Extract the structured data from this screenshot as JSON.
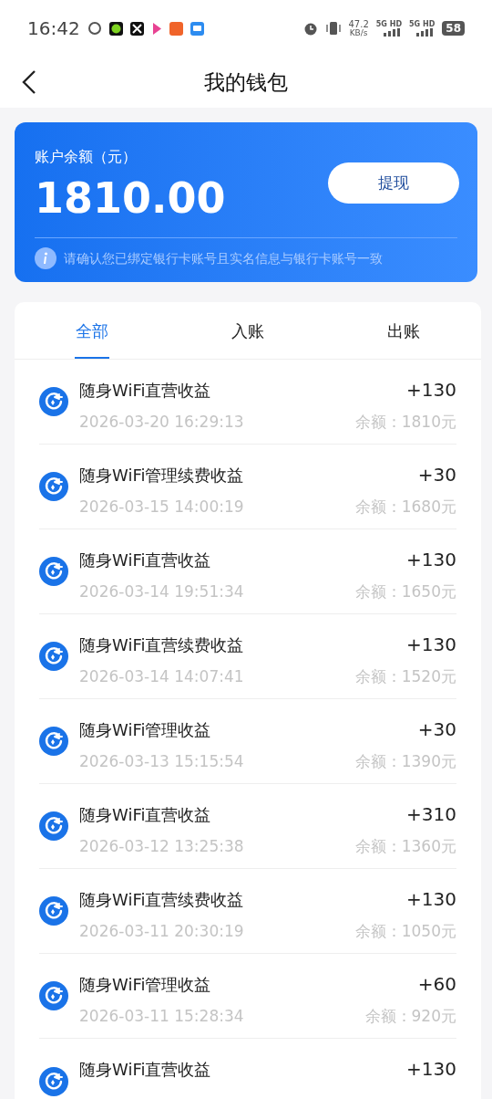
{
  "status_bar": {
    "time": "16:42",
    "speed": "47.2",
    "speed_unit": "KB/s",
    "net_1": "5G HD",
    "net_2": "5G HD",
    "battery": "58"
  },
  "header": {
    "title": "我的钱包"
  },
  "balance_card": {
    "label": "账户余额（元）",
    "amount": "1810.00",
    "button": "提现",
    "notice": "请确认您已绑定银行卡账号且实名信息与银行卡账号一致"
  },
  "tabs": [
    {
      "label": "全部",
      "selected": true
    },
    {
      "label": "入账",
      "selected": false
    },
    {
      "label": "出账",
      "selected": false
    }
  ],
  "transactions": [
    {
      "title": "随身WiFi直营收益",
      "amount": "+130",
      "time": "2026-03-20 16:29:13",
      "balance": "余额：1810元"
    },
    {
      "title": "随身WiFi管理续费收益",
      "amount": "+30",
      "time": "2026-03-15 14:00:19",
      "balance": "余额：1680元"
    },
    {
      "title": "随身WiFi直营收益",
      "amount": "+130",
      "time": "2026-03-14 19:51:34",
      "balance": "余额：1650元"
    },
    {
      "title": "随身WiFi直营续费收益",
      "amount": "+130",
      "time": "2026-03-14 14:07:41",
      "balance": "余额：1520元"
    },
    {
      "title": "随身WiFi管理收益",
      "amount": "+30",
      "time": "2026-03-13 15:15:54",
      "balance": "余额：1390元"
    },
    {
      "title": "随身WiFi直营收益",
      "amount": "+310",
      "time": "2026-03-12 13:25:38",
      "balance": "余额：1360元"
    },
    {
      "title": "随身WiFi直营续费收益",
      "amount": "+130",
      "time": "2026-03-11 20:30:19",
      "balance": "余额：1050元"
    },
    {
      "title": "随身WiFi管理收益",
      "amount": "+60",
      "time": "2026-03-11 15:28:34",
      "balance": "余额：920元"
    },
    {
      "title": "随身WiFi直营收益",
      "amount": "+130"
    }
  ]
}
